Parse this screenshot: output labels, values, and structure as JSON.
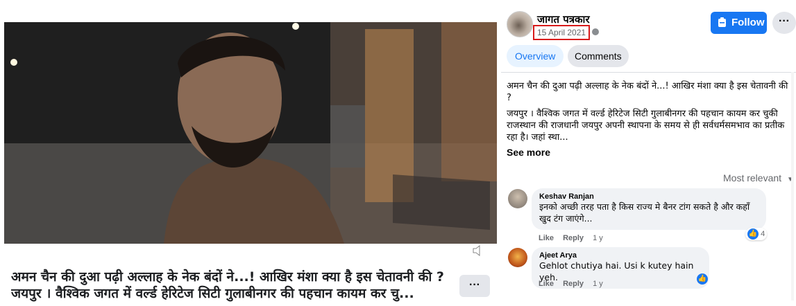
{
  "video": {
    "caption": "अमन चैन की दुआ पढ़ी अल्लाह के नेक बंदों ने...! आखिर मंशा क्या है इस चेतावनी की ? जयपुर । वैश्विक जगत में वर्ल्ड हेरिटेज सिटी गुलाबीनगर की पहचान कायम कर चु...",
    "more_label": "···"
  },
  "post": {
    "page_name": "जागत पत्रकार",
    "date": "15 April 2021",
    "follow_label": "Follow",
    "more_label": "···",
    "tabs": {
      "overview": "Overview",
      "comments": "Comments"
    },
    "description": [
      "अमन चैन की दुआ पढ़ी अल्लाह के नेक बंदों ने...! आखिर मंशा क्या है इस चेतावनी की ?",
      "जयपुर । वैश्विक जगत में वर्ल्ड हेरिटेज सिटी गुलाबीनगर की पहचान कायम कर चुकी राजस्थान की राजधानी जयपुर अपनी स्थापना के समय से ही सर्वधर्मसमभाव का प्रतीक रहा है। जहां स्था..."
    ],
    "see_more": "See more"
  },
  "comments": {
    "sort_label": "Most relevant",
    "items": [
      {
        "author": "Keshav Ranjan",
        "text": "इनको अच्छी तरह पता है किस राज्य मे बैनर टांग सकते है और कहाँ खुद टंग जाएंगे...",
        "like": "Like",
        "reply": "Reply",
        "time": "1 y",
        "reactions": "4"
      },
      {
        "author": "Ajeet Arya",
        "text": "Gehlot chutiya hai. Usi k kutey hain yeh.",
        "like": "Like",
        "reply": "Reply",
        "time": "1 y",
        "reactions": ""
      }
    ]
  }
}
